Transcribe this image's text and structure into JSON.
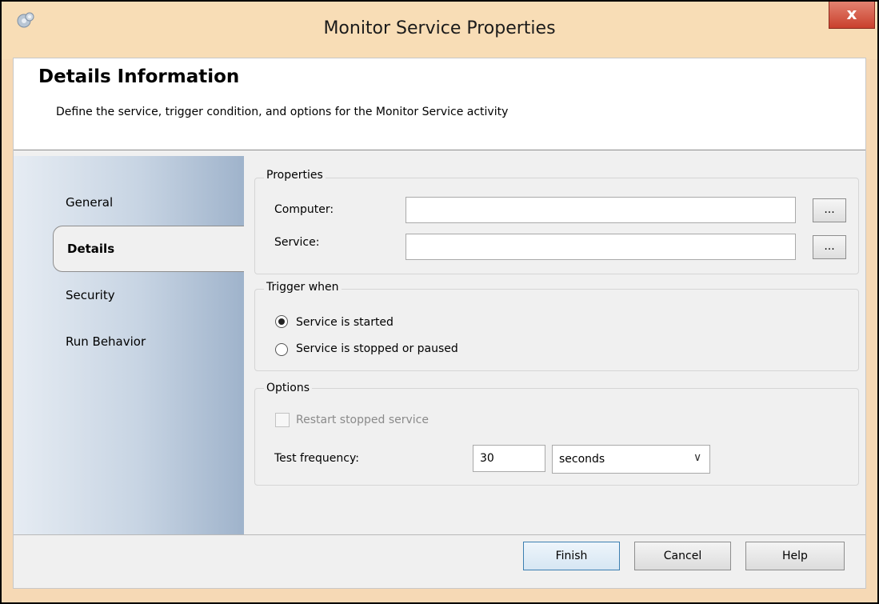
{
  "window": {
    "title": "Monitor Service Properties",
    "close_label": "x"
  },
  "header": {
    "title": "Details Information",
    "description": "Define the service, trigger condition, and options for the Monitor Service activity"
  },
  "sidebar": {
    "items": [
      {
        "label": "General",
        "selected": false
      },
      {
        "label": "Details",
        "selected": true
      },
      {
        "label": "Security",
        "selected": false
      },
      {
        "label": "Run Behavior",
        "selected": false
      }
    ]
  },
  "properties": {
    "legend": "Properties",
    "computer_label": "Computer:",
    "computer_value": "",
    "service_label": "Service:",
    "service_value": "",
    "browse_label": "..."
  },
  "trigger": {
    "legend": "Trigger when",
    "options": [
      {
        "label": "Service is started",
        "selected": true
      },
      {
        "label": "Service is stopped or paused",
        "selected": false
      }
    ]
  },
  "options": {
    "legend": "Options",
    "restart_label": "Restart stopped service",
    "restart_checked": false,
    "test_frequency_label": "Test frequency:",
    "test_frequency_value": "30",
    "unit_selected": "seconds",
    "dropdown_glyph": "∨"
  },
  "buttons": {
    "finish": "Finish",
    "cancel": "Cancel",
    "help": "Help"
  },
  "colors": {
    "titlebar": "#f8ddb6",
    "close_button": "#c9402d",
    "sidebar_gradient_end": "#9fb3cb"
  }
}
